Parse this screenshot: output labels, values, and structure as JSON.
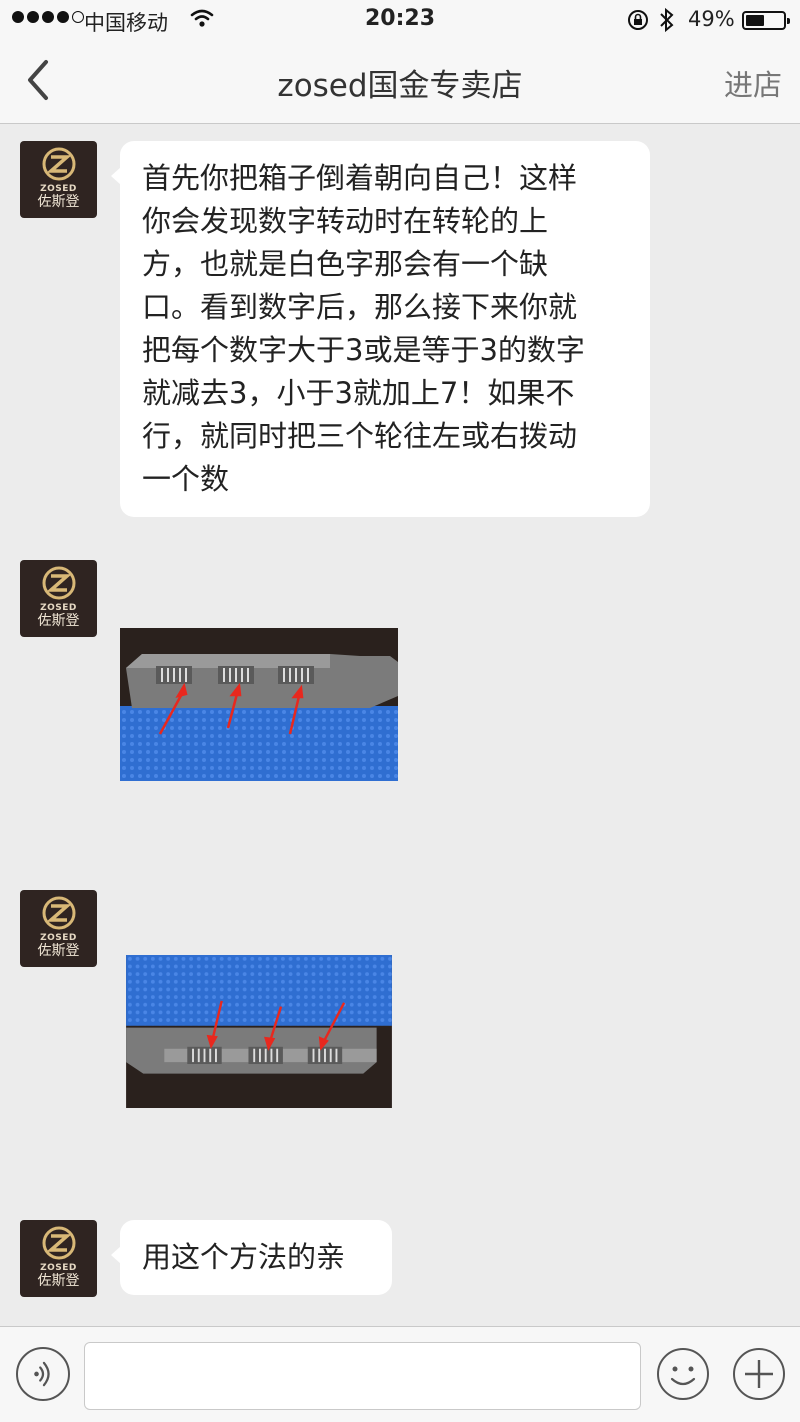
{
  "status": {
    "carrier": "中国移动",
    "time": "20:23",
    "battery": "49%",
    "battery_level": 0.49
  },
  "nav": {
    "title": "zosed国金专卖店",
    "enter_store": "进店"
  },
  "avatar": {
    "brand": "ZOSED",
    "brand_cn": "佐斯登"
  },
  "messages": [
    {
      "type": "text",
      "lines": [
        "首先你把箱子倒着朝向自己！这样",
        "你会发现数字转动时在转轮的上",
        "方，也就是白色字那会有一个缺",
        "口。看到数字后，那么接下来你就",
        "把每个数字大于3或是等于3的数字",
        "就减去3，小于3就加上7！如果不",
        "行，就同时把三个轮往左或右拨动",
        "一个数"
      ]
    },
    {
      "type": "image",
      "icon": "lock-dial-photo-upside-down"
    },
    {
      "type": "image",
      "icon": "lock-dial-photo"
    },
    {
      "type": "text",
      "lines": [
        "用这个方法的亲"
      ]
    }
  ],
  "colors": {
    "background": "#ececec",
    "bar": "#f7f7f7",
    "bubble": "#ffffff",
    "avatar": "#2f2421",
    "arrow": "#e8281e",
    "suitcase": "#2f6ed1"
  }
}
